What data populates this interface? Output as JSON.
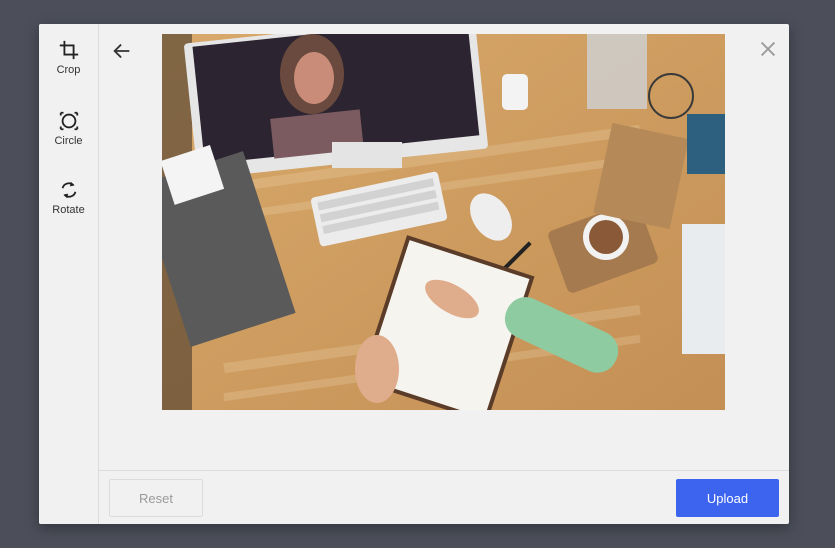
{
  "toolbar": {
    "items": [
      {
        "label": "Crop",
        "icon": "crop-icon"
      },
      {
        "label": "Circle",
        "icon": "circle-crop-icon"
      },
      {
        "label": "Rotate",
        "icon": "rotate-icon"
      }
    ]
  },
  "header": {
    "back_icon": "arrow-left-icon",
    "close_icon": "close-icon"
  },
  "image": {
    "subject": "overhead photo of a wooden desk with a monitor showing a video call, keyboard, mouse, notebook, coffee cup and a hand writing"
  },
  "footer": {
    "reset_label": "Reset",
    "upload_label": "Upload"
  },
  "colors": {
    "accent": "#3c64ef",
    "backdrop": "#4c4f5a",
    "panel": "#f1f1f1"
  }
}
